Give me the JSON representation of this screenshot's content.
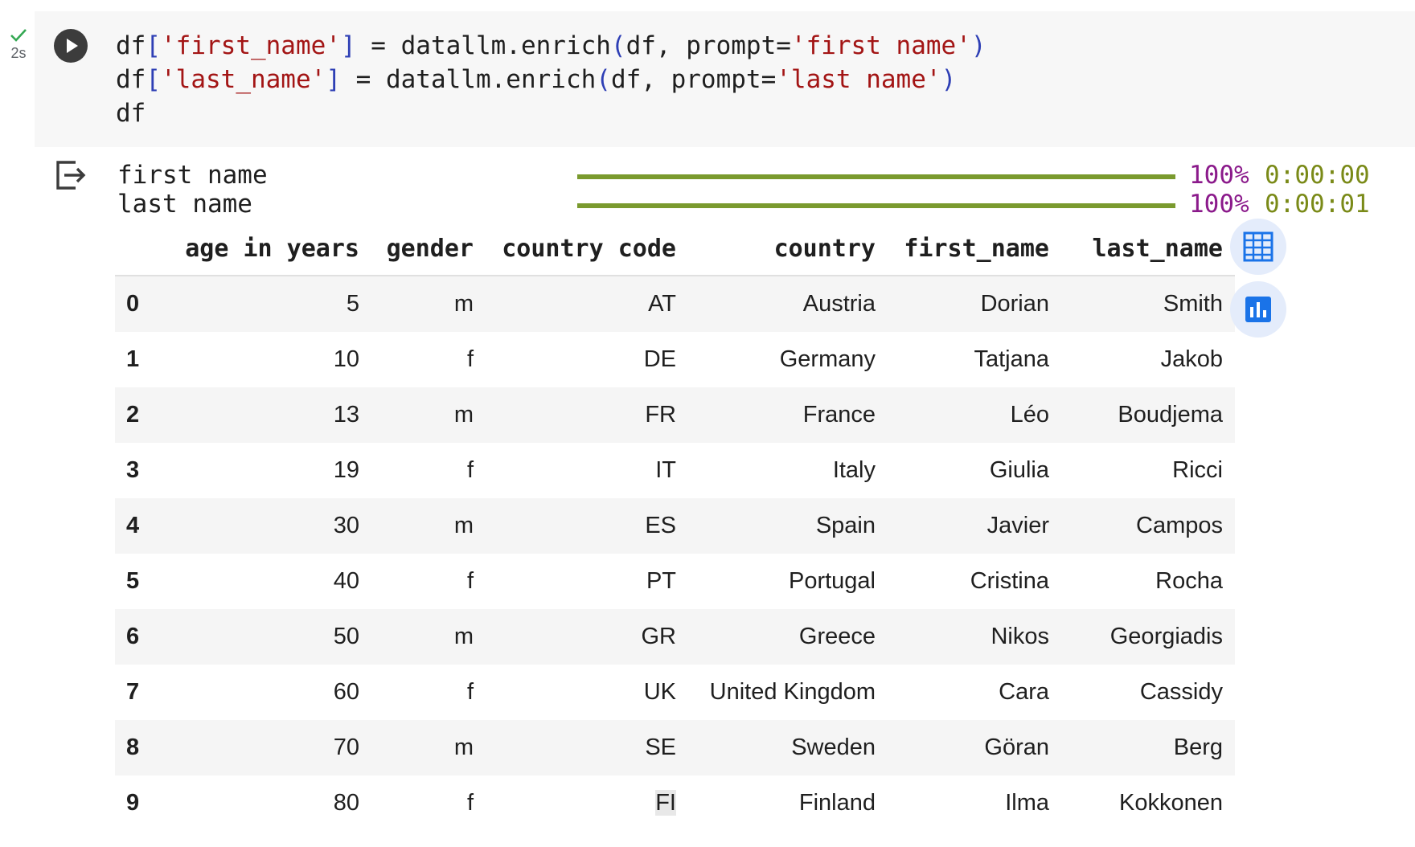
{
  "exec": {
    "time": "2s"
  },
  "code": {
    "line1": {
      "a": "df",
      "b": "[",
      "c": "'first_name'",
      "d": "]",
      "e": " = datallm.enrich",
      "f": "(",
      "g": "df, prompt=",
      "h": "'first name'",
      "i": ")"
    },
    "line2": {
      "a": "df",
      "b": "[",
      "c": "'last_name'",
      "d": "]",
      "e": " = datallm.enrich",
      "f": "(",
      "g": "df, prompt=",
      "h": "'last name'",
      "i": ")"
    },
    "line3": "df"
  },
  "progress": [
    {
      "label": "first name",
      "percent": "100%",
      "elapsed": "0:00:00",
      "fraction": 1.0
    },
    {
      "label": "last name",
      "percent": "100%",
      "elapsed": "0:00:01",
      "fraction": 1.0
    }
  ],
  "table": {
    "columns": [
      "age in years",
      "gender",
      "country code",
      "country",
      "first_name",
      "last_name"
    ],
    "rows": [
      [
        "0",
        "5",
        "m",
        "AT",
        "Austria",
        "Dorian",
        "Smith"
      ],
      [
        "1",
        "10",
        "f",
        "DE",
        "Germany",
        "Tatjana",
        "Jakob"
      ],
      [
        "2",
        "13",
        "m",
        "FR",
        "France",
        "Léo",
        "Boudjema"
      ],
      [
        "3",
        "19",
        "f",
        "IT",
        "Italy",
        "Giulia",
        "Ricci"
      ],
      [
        "4",
        "30",
        "m",
        "ES",
        "Spain",
        "Javier",
        "Campos"
      ],
      [
        "5",
        "40",
        "f",
        "PT",
        "Portugal",
        "Cristina",
        "Rocha"
      ],
      [
        "6",
        "50",
        "m",
        "GR",
        "Greece",
        "Nikos",
        "Georgiadis"
      ],
      [
        "7",
        "60",
        "f",
        "UK",
        "United Kingdom",
        "Cara",
        "Cassidy"
      ],
      [
        "8",
        "70",
        "m",
        "SE",
        "Sweden",
        "Göran",
        "Berg"
      ],
      [
        "9",
        "80",
        "f",
        "FI",
        "Finland",
        "Ilma",
        "Kokkonen"
      ]
    ]
  },
  "icons": {
    "status": "check-icon",
    "run": "play-icon",
    "output": "output-exit-icon",
    "table_view": "table-icon",
    "chart": "bar-chart-icon"
  },
  "colors": {
    "accent": "#1a73e8",
    "progress": "#7a9a2e"
  }
}
